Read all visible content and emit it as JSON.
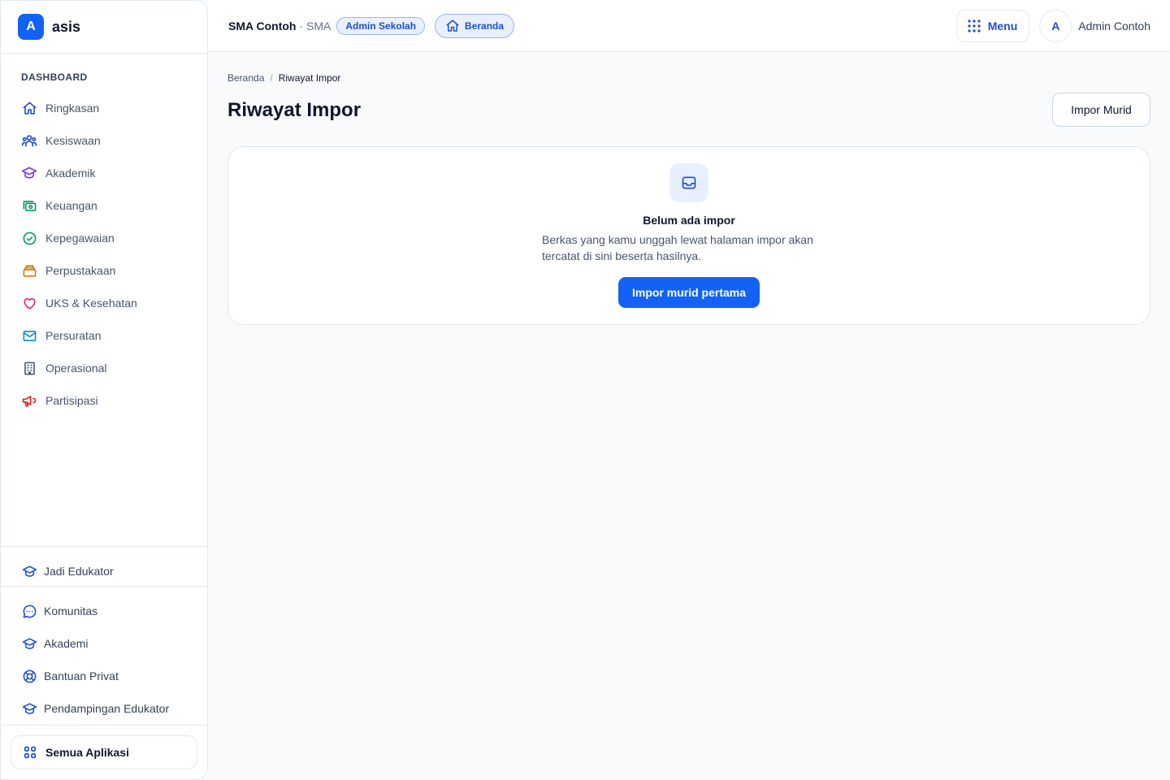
{
  "brand": {
    "logo_letter": "A",
    "name": "asis"
  },
  "sidebar": {
    "section_title": "DASHBOARD",
    "items": [
      {
        "label": "Ringkasan",
        "icon": "home-icon",
        "color": "#1d4ed8"
      },
      {
        "label": "Kesiswaan",
        "icon": "users-icon",
        "color": "#1d4ed8"
      },
      {
        "label": "Akademik",
        "icon": "graduation-cap-icon",
        "color": "#7c3aed"
      },
      {
        "label": "Keuangan",
        "icon": "cash-icon",
        "color": "#059669"
      },
      {
        "label": "Kepegawaian",
        "icon": "badge-check-icon",
        "color": "#059669"
      },
      {
        "label": "Perpustakaan",
        "icon": "library-icon",
        "color": "#d97706"
      },
      {
        "label": "UKS & Kesehatan",
        "icon": "heart-icon",
        "color": "#db2777"
      },
      {
        "label": "Persuratan",
        "icon": "mail-icon",
        "color": "#0891b2"
      },
      {
        "label": "Operasional",
        "icon": "building-icon",
        "color": "#475569"
      },
      {
        "label": "Partisipasi",
        "icon": "megaphone-icon",
        "color": "#dc2626"
      }
    ],
    "bottom_primary": {
      "label": "Jadi Edukator",
      "icon": "graduation-cap-icon"
    },
    "bottom_items": [
      {
        "label": "Komunitas",
        "icon": "chat-icon"
      },
      {
        "label": "Akademi",
        "icon": "graduation-cap-icon"
      },
      {
        "label": "Bantuan Privat",
        "icon": "lifebuoy-icon"
      },
      {
        "label": "Pendampingan Edukator",
        "icon": "graduation-cap-icon"
      }
    ],
    "all_apps_label": "Semua Aplikasi"
  },
  "header": {
    "school_name": "SMA Contoh",
    "school_level": "· SMA",
    "role_badge": "Admin Sekolah",
    "home_badge": "Beranda",
    "menu_label": "Menu",
    "avatar_letter": "A",
    "user_name": "Admin Contoh"
  },
  "main": {
    "breadcrumb": {
      "home": "Beranda",
      "separator": "/",
      "current": "Riwayat Impor"
    },
    "title": "Riwayat Impor",
    "action_button": "Impor Murid",
    "empty_state": {
      "title": "Belum ada impor",
      "description": "Berkas yang kamu unggah lewat halaman impor akan tercatat di sini beserta hasilnya.",
      "button": "Impor murid pertama"
    }
  },
  "colors": {
    "primary": "#1262f5",
    "badge_bg": "#e8f0fe",
    "badge_text": "#1d4ed8",
    "page_bg": "#f8fafc"
  }
}
